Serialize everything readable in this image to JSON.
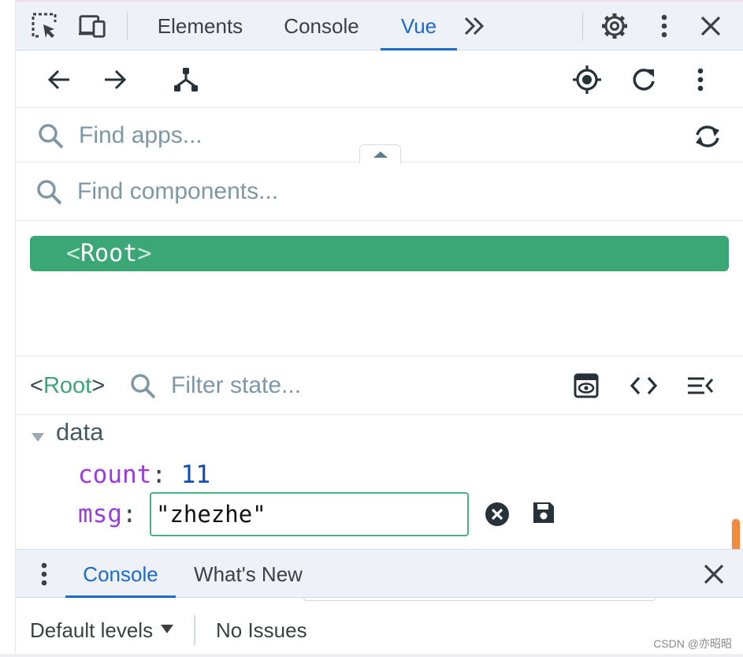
{
  "devtools": {
    "tabs": [
      {
        "label": "Elements",
        "active": false
      },
      {
        "label": "Console",
        "active": false
      },
      {
        "label": "Vue",
        "active": true
      }
    ],
    "icons": [
      "inspect-element-icon",
      "device-toolbar-icon",
      "more-tabs-icon",
      "settings-gear-icon",
      "kebab-menu-icon",
      "close-icon"
    ]
  },
  "vue_toolbar": {
    "icons": [
      "back-arrow-icon",
      "forward-arrow-icon",
      "component-tree-icon",
      "select-component-target-icon",
      "refresh-icon",
      "vue-menu-icon"
    ]
  },
  "app_search": {
    "placeholder": "Find apps..."
  },
  "component_search": {
    "placeholder": "Find components..."
  },
  "component_tree": {
    "selected_node": "Root",
    "open_bracket": "<",
    "close_bracket": ">"
  },
  "inspector": {
    "component_name": "Root",
    "open_bracket": "<",
    "close_bracket": ">",
    "filter_placeholder": "Filter state...",
    "section_title": "data",
    "rows": [
      {
        "key": "count",
        "value": "11"
      },
      {
        "key": "msg",
        "value": "\"zhezhe\""
      }
    ],
    "colon": ":"
  },
  "drawer": {
    "tabs": [
      {
        "label": "Console",
        "active": true
      },
      {
        "label": "What's New",
        "active": false
      }
    ],
    "levels_label": "Default levels",
    "issues_label": "No Issues"
  },
  "watermark": "CSDN @亦昭昭",
  "colors": {
    "accent_blue": "#1a6ad0",
    "vue_green": "#3ba776",
    "key_purple": "#9a3be0",
    "number_blue": "#0b49b8",
    "scroll_orange": "#f08a3c"
  }
}
